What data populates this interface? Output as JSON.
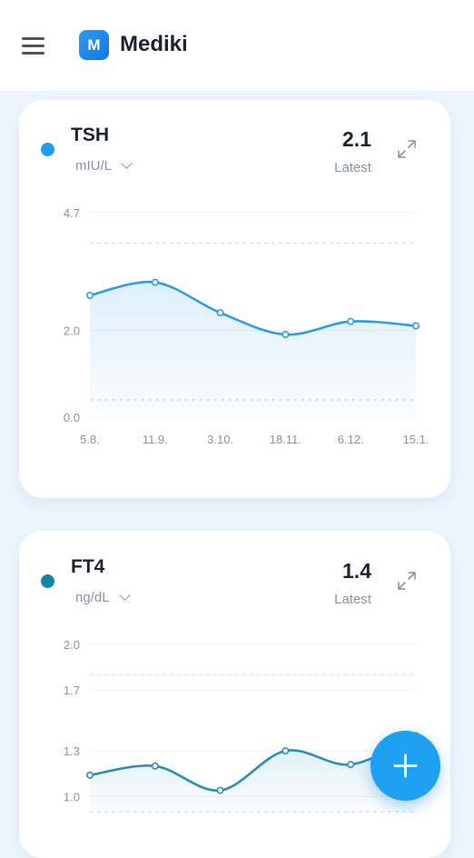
{
  "app": {
    "name": "Mediki",
    "logo_letter": "M"
  },
  "cards": [
    {
      "title": "TSH",
      "unit": "mIU/L",
      "latest_value": "2.1",
      "latest_label": "Latest",
      "dot_color": "#1e9cf0",
      "line_color": "#2f9de6",
      "icons": [
        "chevron-down-icon",
        "expand-icon"
      ],
      "chart_data": {
        "type": "area",
        "x": [
          "5.8.",
          "11.9.",
          "3.10.",
          "18.11.",
          "6.12.",
          "15.1."
        ],
        "y_ticks": [
          "4.7",
          "2.0",
          "0.0"
        ],
        "ylim": [
          0,
          4.7
        ],
        "values": [
          2.8,
          3.1,
          2.4,
          1.9,
          2.2,
          2.1
        ],
        "reference_range": [
          0.4,
          4.0
        ],
        "title": "",
        "xlabel": "",
        "ylabel": ""
      }
    },
    {
      "title": "FT4",
      "unit": "ng/dL",
      "latest_value": "1.4",
      "latest_label": "Latest",
      "dot_color": "#1683a8",
      "line_color": "#2a8fb5",
      "icons": [
        "chevron-down-icon",
        "expand-icon"
      ],
      "chart_data": {
        "type": "area",
        "x": [],
        "y_ticks": [
          "2.0",
          "1.7",
          "1.3",
          "1.0"
        ],
        "ylim": [
          0.9,
          2.0
        ],
        "values": [
          1.14,
          1.2,
          1.04,
          1.3,
          1.21,
          1.4
        ],
        "reference_range": [
          0.9,
          1.8
        ],
        "title": "",
        "xlabel": "",
        "ylabel": ""
      }
    }
  ],
  "fab": {
    "icon": "plus-icon",
    "color": "#1ea1f0"
  }
}
